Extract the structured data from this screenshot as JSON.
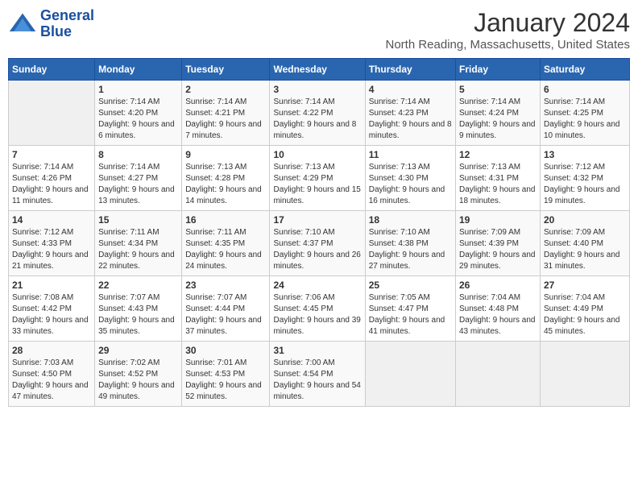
{
  "logo": {
    "line1": "General",
    "line2": "Blue"
  },
  "title": "January 2024",
  "subtitle": "North Reading, Massachusetts, United States",
  "days_of_week": [
    "Sunday",
    "Monday",
    "Tuesday",
    "Wednesday",
    "Thursday",
    "Friday",
    "Saturday"
  ],
  "weeks": [
    [
      {
        "day": "",
        "sunrise": "",
        "sunset": "",
        "daylight": ""
      },
      {
        "day": "1",
        "sunrise": "Sunrise: 7:14 AM",
        "sunset": "Sunset: 4:20 PM",
        "daylight": "Daylight: 9 hours and 6 minutes."
      },
      {
        "day": "2",
        "sunrise": "Sunrise: 7:14 AM",
        "sunset": "Sunset: 4:21 PM",
        "daylight": "Daylight: 9 hours and 7 minutes."
      },
      {
        "day": "3",
        "sunrise": "Sunrise: 7:14 AM",
        "sunset": "Sunset: 4:22 PM",
        "daylight": "Daylight: 9 hours and 8 minutes."
      },
      {
        "day": "4",
        "sunrise": "Sunrise: 7:14 AM",
        "sunset": "Sunset: 4:23 PM",
        "daylight": "Daylight: 9 hours and 8 minutes."
      },
      {
        "day": "5",
        "sunrise": "Sunrise: 7:14 AM",
        "sunset": "Sunset: 4:24 PM",
        "daylight": "Daylight: 9 hours and 9 minutes."
      },
      {
        "day": "6",
        "sunrise": "Sunrise: 7:14 AM",
        "sunset": "Sunset: 4:25 PM",
        "daylight": "Daylight: 9 hours and 10 minutes."
      }
    ],
    [
      {
        "day": "7",
        "sunrise": "Sunrise: 7:14 AM",
        "sunset": "Sunset: 4:26 PM",
        "daylight": "Daylight: 9 hours and 11 minutes."
      },
      {
        "day": "8",
        "sunrise": "Sunrise: 7:14 AM",
        "sunset": "Sunset: 4:27 PM",
        "daylight": "Daylight: 9 hours and 13 minutes."
      },
      {
        "day": "9",
        "sunrise": "Sunrise: 7:13 AM",
        "sunset": "Sunset: 4:28 PM",
        "daylight": "Daylight: 9 hours and 14 minutes."
      },
      {
        "day": "10",
        "sunrise": "Sunrise: 7:13 AM",
        "sunset": "Sunset: 4:29 PM",
        "daylight": "Daylight: 9 hours and 15 minutes."
      },
      {
        "day": "11",
        "sunrise": "Sunrise: 7:13 AM",
        "sunset": "Sunset: 4:30 PM",
        "daylight": "Daylight: 9 hours and 16 minutes."
      },
      {
        "day": "12",
        "sunrise": "Sunrise: 7:13 AM",
        "sunset": "Sunset: 4:31 PM",
        "daylight": "Daylight: 9 hours and 18 minutes."
      },
      {
        "day": "13",
        "sunrise": "Sunrise: 7:12 AM",
        "sunset": "Sunset: 4:32 PM",
        "daylight": "Daylight: 9 hours and 19 minutes."
      }
    ],
    [
      {
        "day": "14",
        "sunrise": "Sunrise: 7:12 AM",
        "sunset": "Sunset: 4:33 PM",
        "daylight": "Daylight: 9 hours and 21 minutes."
      },
      {
        "day": "15",
        "sunrise": "Sunrise: 7:11 AM",
        "sunset": "Sunset: 4:34 PM",
        "daylight": "Daylight: 9 hours and 22 minutes."
      },
      {
        "day": "16",
        "sunrise": "Sunrise: 7:11 AM",
        "sunset": "Sunset: 4:35 PM",
        "daylight": "Daylight: 9 hours and 24 minutes."
      },
      {
        "day": "17",
        "sunrise": "Sunrise: 7:10 AM",
        "sunset": "Sunset: 4:37 PM",
        "daylight": "Daylight: 9 hours and 26 minutes."
      },
      {
        "day": "18",
        "sunrise": "Sunrise: 7:10 AM",
        "sunset": "Sunset: 4:38 PM",
        "daylight": "Daylight: 9 hours and 27 minutes."
      },
      {
        "day": "19",
        "sunrise": "Sunrise: 7:09 AM",
        "sunset": "Sunset: 4:39 PM",
        "daylight": "Daylight: 9 hours and 29 minutes."
      },
      {
        "day": "20",
        "sunrise": "Sunrise: 7:09 AM",
        "sunset": "Sunset: 4:40 PM",
        "daylight": "Daylight: 9 hours and 31 minutes."
      }
    ],
    [
      {
        "day": "21",
        "sunrise": "Sunrise: 7:08 AM",
        "sunset": "Sunset: 4:42 PM",
        "daylight": "Daylight: 9 hours and 33 minutes."
      },
      {
        "day": "22",
        "sunrise": "Sunrise: 7:07 AM",
        "sunset": "Sunset: 4:43 PM",
        "daylight": "Daylight: 9 hours and 35 minutes."
      },
      {
        "day": "23",
        "sunrise": "Sunrise: 7:07 AM",
        "sunset": "Sunset: 4:44 PM",
        "daylight": "Daylight: 9 hours and 37 minutes."
      },
      {
        "day": "24",
        "sunrise": "Sunrise: 7:06 AM",
        "sunset": "Sunset: 4:45 PM",
        "daylight": "Daylight: 9 hours and 39 minutes."
      },
      {
        "day": "25",
        "sunrise": "Sunrise: 7:05 AM",
        "sunset": "Sunset: 4:47 PM",
        "daylight": "Daylight: 9 hours and 41 minutes."
      },
      {
        "day": "26",
        "sunrise": "Sunrise: 7:04 AM",
        "sunset": "Sunset: 4:48 PM",
        "daylight": "Daylight: 9 hours and 43 minutes."
      },
      {
        "day": "27",
        "sunrise": "Sunrise: 7:04 AM",
        "sunset": "Sunset: 4:49 PM",
        "daylight": "Daylight: 9 hours and 45 minutes."
      }
    ],
    [
      {
        "day": "28",
        "sunrise": "Sunrise: 7:03 AM",
        "sunset": "Sunset: 4:50 PM",
        "daylight": "Daylight: 9 hours and 47 minutes."
      },
      {
        "day": "29",
        "sunrise": "Sunrise: 7:02 AM",
        "sunset": "Sunset: 4:52 PM",
        "daylight": "Daylight: 9 hours and 49 minutes."
      },
      {
        "day": "30",
        "sunrise": "Sunrise: 7:01 AM",
        "sunset": "Sunset: 4:53 PM",
        "daylight": "Daylight: 9 hours and 52 minutes."
      },
      {
        "day": "31",
        "sunrise": "Sunrise: 7:00 AM",
        "sunset": "Sunset: 4:54 PM",
        "daylight": "Daylight: 9 hours and 54 minutes."
      },
      {
        "day": "",
        "sunrise": "",
        "sunset": "",
        "daylight": ""
      },
      {
        "day": "",
        "sunrise": "",
        "sunset": "",
        "daylight": ""
      },
      {
        "day": "",
        "sunrise": "",
        "sunset": "",
        "daylight": ""
      }
    ]
  ]
}
